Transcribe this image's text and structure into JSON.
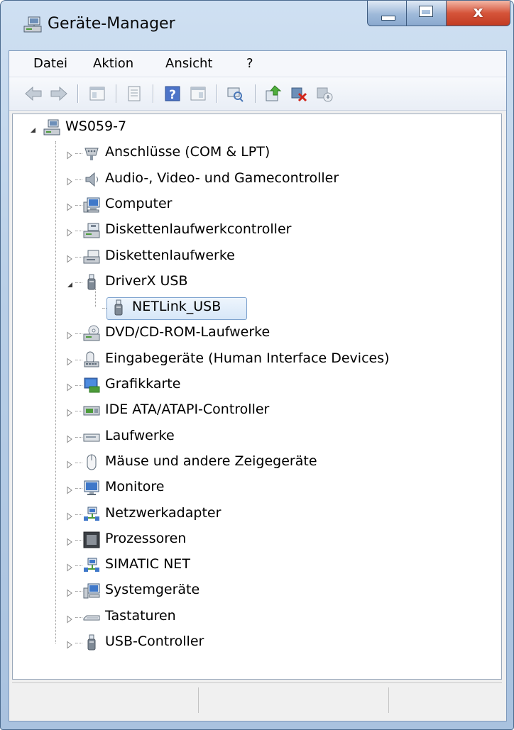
{
  "window": {
    "title": "Geräte-Manager",
    "controls": {
      "minimize": "minimize",
      "maximize": "maximize",
      "close": "x"
    }
  },
  "menu": [
    {
      "label": "Datei"
    },
    {
      "label": "Aktion"
    },
    {
      "label": "Ansicht"
    },
    {
      "label": "?"
    }
  ],
  "toolbar": [
    {
      "icon": "back-arrow-icon"
    },
    {
      "icon": "forward-arrow-icon"
    },
    {
      "icon": "show-hide-console-tree-icon"
    },
    {
      "icon": "properties-icon"
    },
    {
      "icon": "help-icon"
    },
    {
      "icon": "show-action-pane-icon"
    },
    {
      "icon": "scan-hardware-changes-icon"
    },
    {
      "icon": "update-driver-icon"
    },
    {
      "icon": "uninstall-device-icon"
    },
    {
      "icon": "disable-device-icon"
    }
  ],
  "tree": {
    "root": {
      "label": "WS059-7",
      "expanded": true,
      "icon": "computer-network-icon"
    },
    "items": [
      {
        "label": "Anschlüsse (COM & LPT)",
        "icon": "port-icon"
      },
      {
        "label": "Audio-, Video- und Gamecontroller",
        "icon": "speaker-icon"
      },
      {
        "label": "Computer",
        "icon": "computer-icon"
      },
      {
        "label": "Diskettenlaufwerkcontroller",
        "icon": "floppy-controller-icon"
      },
      {
        "label": "Diskettenlaufwerke",
        "icon": "floppy-drive-icon"
      },
      {
        "label": "DriverX USB",
        "icon": "usb-plug-icon",
        "expanded": true,
        "children": [
          {
            "label": "NETLink_USB",
            "icon": "usb-plug-icon",
            "selected": true
          }
        ]
      },
      {
        "label": "DVD/CD-ROM-Laufwerke",
        "icon": "dvd-drive-icon"
      },
      {
        "label": "Eingabegeräte (Human Interface Devices)",
        "icon": "hid-icon"
      },
      {
        "label": "Grafikkarte",
        "icon": "display-adapter-icon"
      },
      {
        "label": "IDE ATA/ATAPI-Controller",
        "icon": "ide-controller-icon"
      },
      {
        "label": "Laufwerke",
        "icon": "disk-drive-icon"
      },
      {
        "label": "Mäuse und andere Zeigegeräte",
        "icon": "mouse-icon"
      },
      {
        "label": "Monitore",
        "icon": "monitor-icon"
      },
      {
        "label": "Netzwerkadapter",
        "icon": "network-adapter-icon"
      },
      {
        "label": "Prozessoren",
        "icon": "processor-icon"
      },
      {
        "label": "SIMATIC NET",
        "icon": "network-adapter-icon"
      },
      {
        "label": "Systemgeräte",
        "icon": "system-device-icon"
      },
      {
        "label": "Tastaturen",
        "icon": "keyboard-icon"
      },
      {
        "label": "USB-Controller",
        "icon": "usb-plug-icon"
      }
    ]
  },
  "statusbar": {
    "segments": [
      "",
      "",
      ""
    ]
  }
}
